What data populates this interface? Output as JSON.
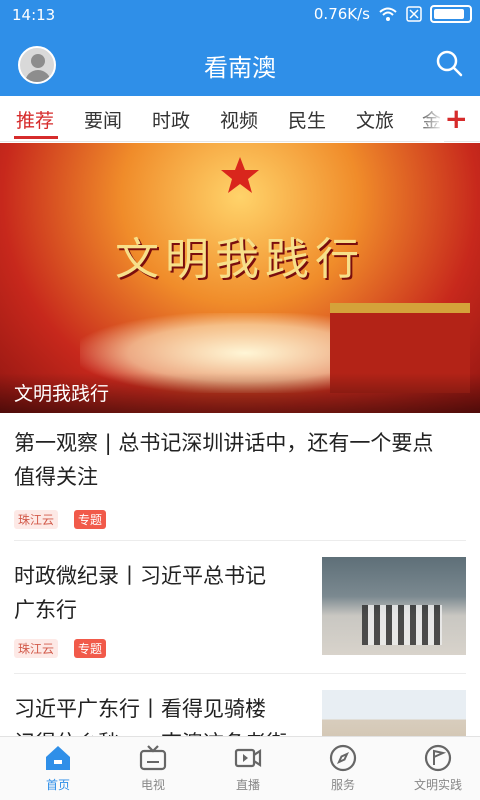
{
  "status_bar": {
    "time": "14:13",
    "network_speed": "0.76K/s"
  },
  "header": {
    "title": "看南澳"
  },
  "tabs": [
    {
      "label": "推荐",
      "active": true
    },
    {
      "label": "要闻"
    },
    {
      "label": "时政"
    },
    {
      "label": "视频"
    },
    {
      "label": "民生"
    },
    {
      "label": "文旅"
    },
    {
      "label": "金"
    }
  ],
  "tabs_more": "+",
  "banner": {
    "slogan": "文明我践行",
    "caption": "文明我践行"
  },
  "articles": [
    {
      "title_lines": [
        "第一观察 | 总书记深圳讲话中，还有一个要点",
        "值得关注"
      ],
      "source": "珠江云",
      "tag": "专题"
    },
    {
      "title_lines": [
        "时政微纪录丨习近平总书记",
        "广东行"
      ],
      "source": "珠江云",
      "tag": "专题"
    },
    {
      "title_lines": [
        "习近平广东行丨看得见骑楼",
        "记得住乡愁……南澳这条老街"
      ]
    }
  ],
  "bottom_nav": [
    {
      "label": "首页",
      "icon": "home-icon",
      "active": true
    },
    {
      "label": "电视",
      "icon": "tv-icon"
    },
    {
      "label": "直播",
      "icon": "live-video-icon"
    },
    {
      "label": "服务",
      "icon": "compass-icon"
    },
    {
      "label": "文明实践",
      "icon": "flag-icon"
    }
  ],
  "colors": {
    "brand_blue": "#2f8fe8",
    "accent_red": "#d62b2b",
    "tag_red": "#f15a4a"
  }
}
